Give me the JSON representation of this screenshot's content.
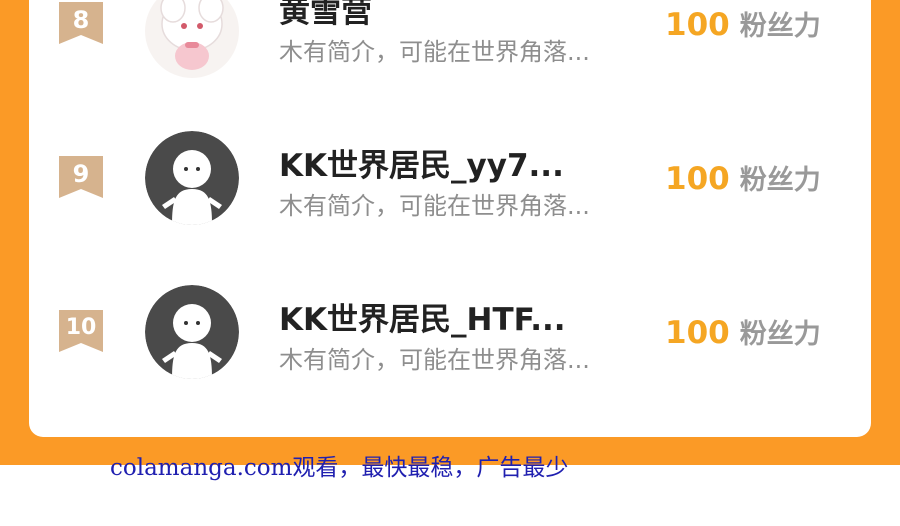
{
  "colors": {
    "background_accent": "#fb9a26",
    "card": "#ffffff",
    "rank_badge": "#d6b38e",
    "fans_value": "#f5a623",
    "fans_label": "#999999",
    "name": "#222222",
    "bio": "#8e8e8e",
    "footer_link": "#2020b0"
  },
  "ranking": {
    "rows": [
      {
        "rank": "8",
        "name": "黄雪营",
        "bio": "木有简介，可能在世界角落...",
        "fans_value": "100",
        "fans_label": "粉丝力",
        "avatar_icon": "anime-girl-avatar-icon"
      },
      {
        "rank": "9",
        "name": "KK世界居民_yy7...",
        "bio": "木有简介，可能在世界角落...",
        "fans_value": "100",
        "fans_label": "粉丝力",
        "avatar_icon": "default-user-avatar-icon"
      },
      {
        "rank": "10",
        "name": "KK世界居民_HTF...",
        "bio": "木有简介，可能在世界角落...",
        "fans_value": "100",
        "fans_label": "粉丝力",
        "avatar_icon": "default-user-avatar-icon"
      }
    ]
  },
  "footer": {
    "watermark_text": "colamanga.com观看，最快最稳，广告最少"
  }
}
